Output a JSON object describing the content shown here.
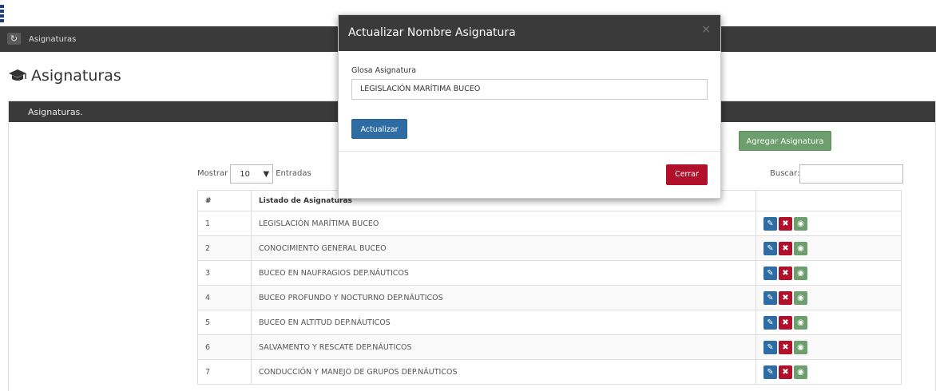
{
  "breadcrumb": {
    "icon": "refresh-icon",
    "label": "Asignaturas"
  },
  "page": {
    "title": "Asignaturas",
    "title_icon": "graduation-cap-icon"
  },
  "panel": {
    "heading": "Asignaturas."
  },
  "toolbar": {
    "add_label": "Agregar Asignatura"
  },
  "length": {
    "prefix": "Mostrar",
    "value": "10",
    "suffix": "Entradas"
  },
  "search": {
    "label": "Buscar:",
    "value": ""
  },
  "table": {
    "headers": [
      "#",
      "Listado de Asignaturas",
      ""
    ],
    "rows": [
      {
        "num": "1",
        "name": "LEGISLACIÓN MARÍTIMA BUCEO"
      },
      {
        "num": "2",
        "name": "CONOCIMIENTO GENERAL BUCEO"
      },
      {
        "num": "3",
        "name": "BUCEO EN NAUFRAGIOS DEP.NÁUTICOS"
      },
      {
        "num": "4",
        "name": "BUCEO PROFUNDO Y NOCTURNO DEP.NÁUTICOS"
      },
      {
        "num": "5",
        "name": "BUCEO EN ALTITUD DEP.NÁUTICOS"
      },
      {
        "num": "6",
        "name": "SALVAMENTO Y RESCATE DEP.NÁUTICOS"
      },
      {
        "num": "7",
        "name": "CONDUCCIÓN Y MANEJO DE GRUPOS DEP.NÁUTICOS"
      }
    ]
  },
  "modal": {
    "title": "Actualizar Nombre Asignatura",
    "close_glyph": "×",
    "field_label": "Glosa Asignatura",
    "field_value": "LEGISLACIÓN MARÍTIMA  BUCEO",
    "update_label": "Actualizar",
    "close_label": "Cerrar"
  },
  "colors": {
    "header_bar": "#3a3a3a",
    "primary": "#2e6da4",
    "danger": "#b0102a",
    "success": "#6d9e6d"
  }
}
